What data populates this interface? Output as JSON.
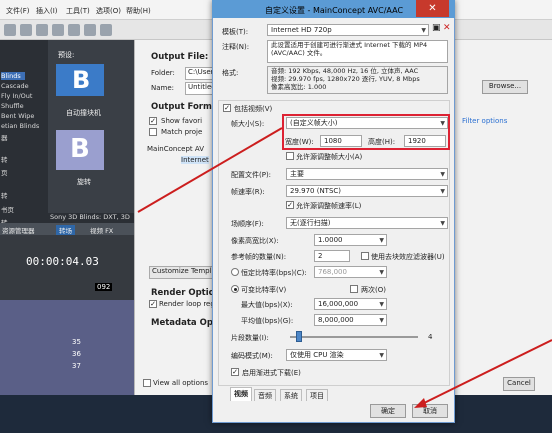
{
  "vegas": {
    "menu": [
      "文件(F)",
      "编辑(E)",
      "视图(V)",
      "插入(I)",
      "工具(T)",
      "选项(O)",
      "帮助(H)"
    ],
    "transitions_header": "预设:",
    "transition_list": [
      "Blinds",
      "Cascade",
      "Fly In/Out",
      "Shuffle",
      "Bent Wipe",
      "etian Blinds",
      "器",
      "",
      "转",
      "",
      "页",
      "",
      "",
      "转",
      "",
      "",
      "书页",
      "",
      "转"
    ],
    "thumb1_caption": "自动撞块机",
    "thumb2_caption": "旋转",
    "sony_line": "Sony 3D Blinds: DXT, 3D",
    "bottom_tabs": [
      "资源管理器",
      "转场",
      "视频 FX"
    ],
    "timecode": "00:00:04.03",
    "bottom_number": "092",
    "track_values": [
      "35",
      "36",
      "37"
    ]
  },
  "output": {
    "file_header": "Output File:",
    "folder_label": "Folder:",
    "folder_value": "C:\\Users",
    "name_label": "Name:",
    "name_value": "Untitled",
    "format_header": "Output Format:",
    "show_fav": "Show favori",
    "match_proj": "Match proje",
    "tree_item": "MainConcept AV",
    "tree_sub": "Internet",
    "customize_btn": "Customize Templ",
    "render_header": "Render Options",
    "render_loop": "Render loop regi",
    "metadata_header": "Metadata Optio",
    "view_all": "View all options",
    "browse_btn": "Browse...",
    "filter_link": "Filter options",
    "cancel_btn": "Cancel"
  },
  "dialog": {
    "title": "自定义设置 - MainConcept AVC/AAC",
    "close_glyph": "✕",
    "template_label": "模板(T):",
    "template_value": "Internet HD 720p",
    "notes_label": "注释(N):",
    "notes_value": "此设置适用于创建可进行渐进式 Internet 下载的 MP4 (AVC/AAC) 文件。",
    "format_label": "格式:",
    "format_lines": [
      "音频: 192 Kbps, 48,000 Hz, 16 位, 立体声, AAC",
      "视频: 29.970 fps, 1280x720 逐行, YUV, 8 Mbps",
      "像素高宽比: 1.000"
    ],
    "include_video": "包括视频(V)",
    "frame_size_label": "帧大小(S):",
    "frame_size_value": "(自定义帧大小)",
    "width_label": "宽度(W):",
    "width_value": "1080",
    "height_label": "高度(H):",
    "height_value": "1920",
    "allow_frame": "允许源调整帧大小(A)",
    "profile_label": "配置文件(P):",
    "profile_value": "主要",
    "framerate_label": "帧速率(R):",
    "framerate_value": "29.970 (NTSC)",
    "allow_rate": "允许源调整帧速率(L)",
    "field_order_label": "场顺序(F):",
    "field_order_value": "无(逐行扫描)",
    "par_label": "像素高宽比(X):",
    "par_value": "1.0000",
    "ref_label": "参考帧的数量(N):",
    "ref_value": "2",
    "deblock": "使用去块效应滤波器(U)",
    "cbr_label": "恒定比特率(bps)(C):",
    "cbr_value": "768,000",
    "vbr_label": "可变比特率(V)",
    "twopass": "两次(O)",
    "max_label": "最大值(bps)(X):",
    "max_value": "16,000,000",
    "avg_label": "平均值(bps)(G):",
    "avg_value": "8,000,000",
    "slices_label": "片段数量(I):",
    "slices_value": "4",
    "encode_label": "编码模式(M):",
    "encode_value": "仅使用 CPU 渲染",
    "progressive": "启用渐进式下载(E)",
    "tabs": [
      "视频",
      "音频",
      "系统",
      "项目"
    ],
    "ok_btn": "确定",
    "cancel_btn": "取消"
  },
  "colors": {
    "title_bar": "#5b9bd5",
    "highlight_red": "#dd2233",
    "arrow_red": "#cc1e1e"
  }
}
